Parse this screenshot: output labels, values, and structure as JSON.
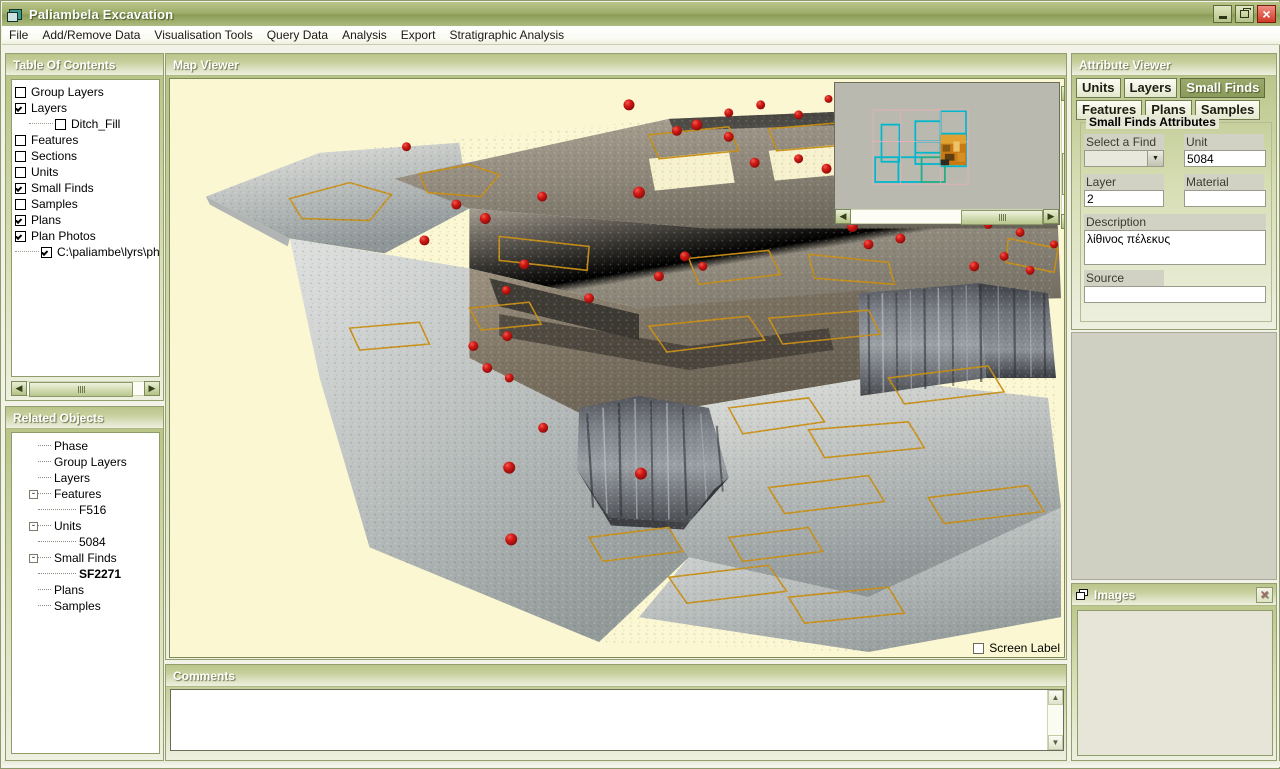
{
  "window": {
    "title": "Paliambela Excavation",
    "icon": "application-icon",
    "controls": {
      "minimize": "_",
      "restore": "❐",
      "close": "×"
    }
  },
  "menubar": {
    "items": [
      {
        "label": "File"
      },
      {
        "label": "Add/Remove Data"
      },
      {
        "label": "Visualisation Tools"
      },
      {
        "label": "Query Data"
      },
      {
        "label": "Analysis"
      },
      {
        "label": "Export"
      },
      {
        "label": "Stratigraphic Analysis"
      }
    ]
  },
  "toc": {
    "title": "Table Of Contents",
    "items": [
      {
        "label": "Group Layers",
        "checked": false,
        "depth": 0
      },
      {
        "label": "Layers",
        "checked": true,
        "depth": 0
      },
      {
        "label": "Ditch_Fill",
        "checked": false,
        "depth": 1
      },
      {
        "label": "Features",
        "checked": false,
        "depth": 0
      },
      {
        "label": "Sections",
        "checked": false,
        "depth": 0
      },
      {
        "label": "Units",
        "checked": false,
        "depth": 0
      },
      {
        "label": "Small Finds",
        "checked": true,
        "depth": 0
      },
      {
        "label": "Samples",
        "checked": false,
        "depth": 0
      },
      {
        "label": "Plans",
        "checked": true,
        "depth": 0
      },
      {
        "label": "Plan Photos",
        "checked": true,
        "depth": 0
      },
      {
        "label": "C:\\paliambe\\lyrs\\ph",
        "checked": true,
        "depth": 1
      }
    ]
  },
  "related_objects": {
    "title": "Related Objects",
    "items": [
      {
        "label": "Phase",
        "depth": 0,
        "expander": null,
        "bold": false
      },
      {
        "label": "Group Layers",
        "depth": 0,
        "expander": null,
        "bold": false
      },
      {
        "label": "Layers",
        "depth": 0,
        "expander": null,
        "bold": false
      },
      {
        "label": "Features",
        "depth": 0,
        "expander": "-",
        "bold": false
      },
      {
        "label": "F516",
        "depth": 1,
        "expander": null,
        "bold": false
      },
      {
        "label": "Units",
        "depth": 0,
        "expander": "-",
        "bold": false
      },
      {
        "label": "5084",
        "depth": 1,
        "expander": null,
        "bold": false
      },
      {
        "label": "Small Finds",
        "depth": 0,
        "expander": "-",
        "bold": false
      },
      {
        "label": "SF2271",
        "depth": 1,
        "expander": null,
        "bold": true
      },
      {
        "label": "Plans",
        "depth": 0,
        "expander": null,
        "bold": false
      },
      {
        "label": "Samples",
        "depth": 0,
        "expander": null,
        "bold": false
      }
    ]
  },
  "map_viewer": {
    "title": "Map Viewer",
    "background_color": "#fbf7d2",
    "screen_label": {
      "label": "Screen Label",
      "checked": false
    },
    "overview": {
      "background_color": "#b9b9b0",
      "frame_color": "#00b4c8",
      "thumbnail_color": "#d98b1e"
    },
    "markers": {
      "color": "#cc1414",
      "name": "small-find-marker"
    }
  },
  "comments": {
    "title": "Comments",
    "value": "",
    "placeholder": ""
  },
  "attribute_viewer": {
    "title": "Attribute Viewer",
    "tabs_row1": [
      {
        "label": "Units",
        "active": false
      },
      {
        "label": "Layers",
        "active": false
      },
      {
        "label": "Small Finds",
        "active": true
      }
    ],
    "tabs_row2": [
      {
        "label": "Features",
        "active": false
      },
      {
        "label": "Plans",
        "active": false
      },
      {
        "label": "Samples",
        "active": false
      }
    ],
    "group_title": "Small Finds Attributes",
    "fields": {
      "select_a_find": {
        "label": "Select a Find",
        "value": ""
      },
      "unit": {
        "label": "Unit",
        "value": "5084"
      },
      "layer": {
        "label": "Layer",
        "value": "2"
      },
      "material": {
        "label": "Material",
        "value": ""
      },
      "description": {
        "label": "Description",
        "value": "λίθινος πέλεκυς"
      },
      "source": {
        "label": "Source",
        "value": ""
      }
    }
  },
  "images_panel": {
    "title": "Images",
    "icon": "images-icon",
    "close_label": "×"
  }
}
